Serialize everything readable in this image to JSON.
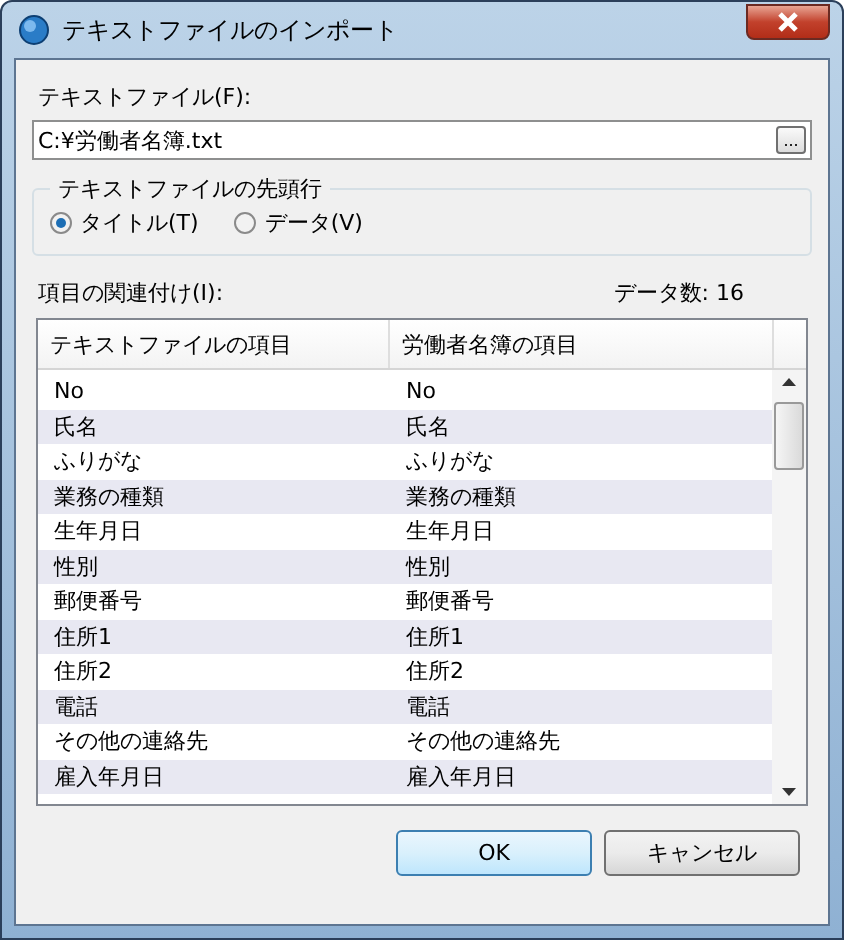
{
  "window": {
    "title": "テキストファイルのインポート"
  },
  "file": {
    "label": "テキストファイル(F):",
    "value": "C:¥労働者名簿.txt",
    "browse": "..."
  },
  "first_row": {
    "title": "テキストファイルの先頭行",
    "options": [
      {
        "label": "タイトル(T)",
        "selected": true
      },
      {
        "label": "データ(V)",
        "selected": false
      }
    ]
  },
  "mapping": {
    "label": "項目の関連付け(I):",
    "count": "データ数:  16"
  },
  "table": {
    "columns": [
      "テキストファイルの項目",
      "労働者名簿の項目"
    ],
    "rows": [
      [
        "No",
        "No"
      ],
      [
        "氏名",
        "氏名"
      ],
      [
        "ふりがな",
        "ふりがな"
      ],
      [
        "業務の種類",
        "業務の種類"
      ],
      [
        "生年月日",
        "生年月日"
      ],
      [
        "性別",
        "性別"
      ],
      [
        "郵便番号",
        "郵便番号"
      ],
      [
        "住所1",
        "住所1"
      ],
      [
        "住所2",
        "住所2"
      ],
      [
        "電話",
        "電話"
      ],
      [
        "その他の連絡先",
        "その他の連絡先"
      ],
      [
        "雇入年月日",
        "雇入年月日"
      ]
    ]
  },
  "buttons": [
    "OK",
    "キャンセル"
  ]
}
